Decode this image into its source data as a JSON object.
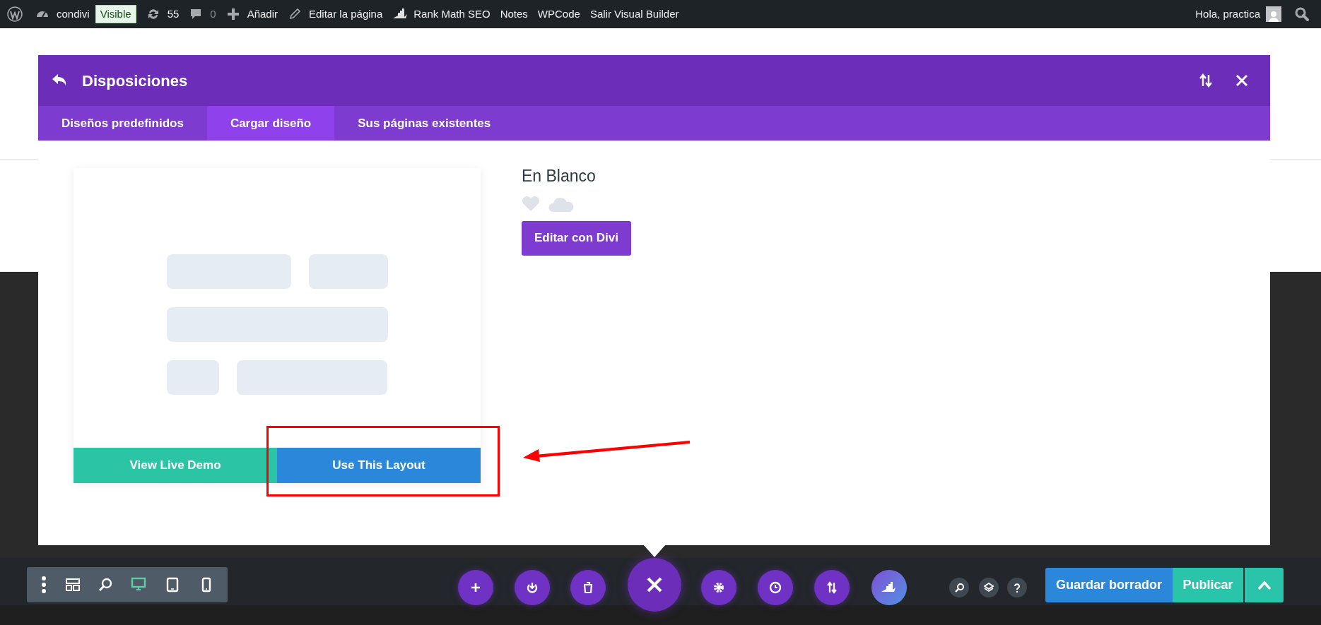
{
  "admin_bar": {
    "items": [
      {
        "kind": "site",
        "label": "condivi"
      },
      {
        "kind": "badge",
        "label": "Visible"
      },
      {
        "kind": "updates",
        "label": "55"
      },
      {
        "kind": "comments",
        "label": "0"
      },
      {
        "kind": "add",
        "label": "Añadir"
      },
      {
        "kind": "edit",
        "label": "Editar la página"
      },
      {
        "kind": "rankmath",
        "label": "Rank Math SEO"
      },
      {
        "kind": "text",
        "label": "Notes"
      },
      {
        "kind": "text",
        "label": "WPCode"
      },
      {
        "kind": "text",
        "label": "Salir Visual Builder"
      }
    ],
    "greeting": "Hola, practica"
  },
  "modal": {
    "title": "Disposiciones",
    "tabs": [
      {
        "label": "Diseños predefinidos",
        "selected": false
      },
      {
        "label": "Cargar diseño",
        "selected": true
      },
      {
        "label": "Sus páginas existentes",
        "selected": false
      }
    ],
    "layout": {
      "name": "En Blanco",
      "edit_button": "Editar con Divi",
      "demo_button": "View Live Demo",
      "use_button": "Use This Layout"
    }
  },
  "bottom_bar": {
    "view_modes": [
      {
        "kind": "desktop",
        "selected": true
      },
      {
        "kind": "tablet",
        "selected": false
      },
      {
        "kind": "phone",
        "selected": false
      }
    ],
    "save_button": "Guardar borrador",
    "publish_button": "Publicar"
  }
}
